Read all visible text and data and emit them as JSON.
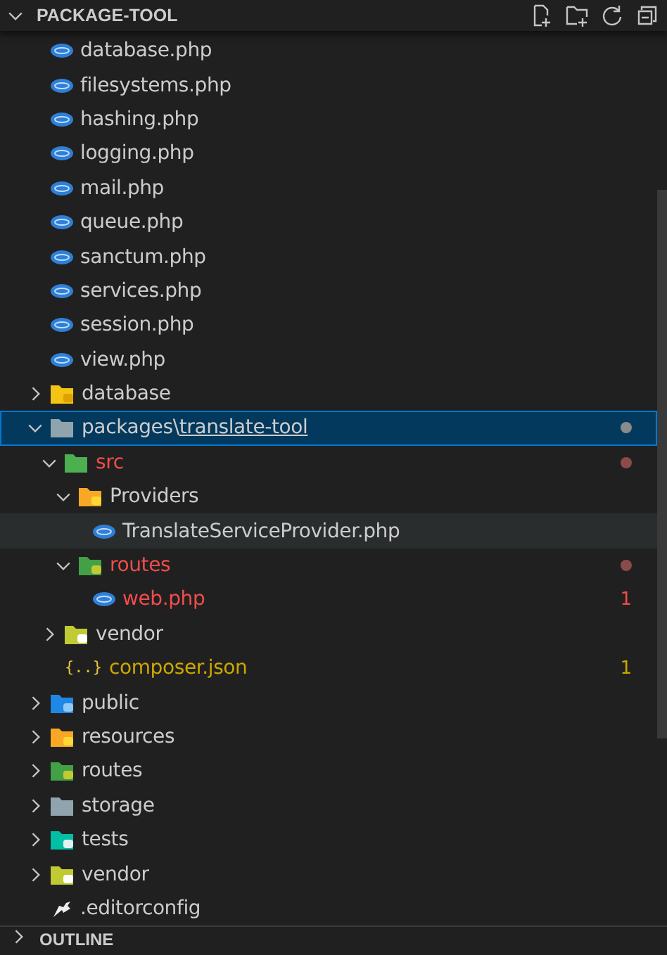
{
  "header": {
    "title": "PACKAGE-TOOL",
    "expanded": true
  },
  "tree": [
    {
      "kind": "scrolled-folder",
      "children": [
        {
          "kind": "php",
          "label": "database.php"
        },
        {
          "kind": "php",
          "label": "filesystems.php"
        },
        {
          "kind": "php",
          "label": "hashing.php"
        },
        {
          "kind": "php",
          "label": "logging.php"
        },
        {
          "kind": "php",
          "label": "mail.php"
        },
        {
          "kind": "php",
          "label": "queue.php"
        },
        {
          "kind": "php",
          "label": "sanctum.php"
        },
        {
          "kind": "php",
          "label": "services.php"
        },
        {
          "kind": "php",
          "label": "session.php"
        },
        {
          "kind": "php",
          "label": "view.php"
        }
      ]
    },
    {
      "kind": "folder-database",
      "label": "database",
      "expanded": false,
      "selected": false
    },
    {
      "kind": "folder-plain",
      "label": "packages",
      "separator": "\\",
      "sublabel": "translate-tool",
      "expanded": true,
      "selected": true,
      "dot": true,
      "children": [
        {
          "kind": "folder-src",
          "label": "src",
          "expanded": true,
          "selected": false,
          "error": true,
          "dot": true,
          "children": [
            {
              "kind": "folder-providers",
              "label": "Providers",
              "expanded": true,
              "selected": false,
              "children": [
                {
                  "kind": "php",
                  "label": "TranslateServiceProvider.php",
                  "hovered": true
                }
              ]
            },
            {
              "kind": "folder-routes",
              "label": "routes",
              "expanded": true,
              "selected": false,
              "error": true,
              "dot": true,
              "children": [
                {
                  "kind": "php",
                  "label": "web.php",
                  "error": true,
                  "badge": "1"
                }
              ]
            }
          ]
        },
        {
          "kind": "folder-vendor",
          "label": "vendor",
          "expanded": false,
          "selected": false
        },
        {
          "kind": "json",
          "glyph": "{..}",
          "label": "composer.json",
          "warning": true,
          "badge": "1"
        }
      ]
    },
    {
      "kind": "folder-public",
      "label": "public",
      "expanded": false,
      "selected": false
    },
    {
      "kind": "folder-resources",
      "label": "resources",
      "expanded": false,
      "selected": false
    },
    {
      "kind": "folder-routes",
      "label": "routes",
      "expanded": false,
      "selected": false
    },
    {
      "kind": "folder-plain",
      "label": "storage",
      "expanded": false,
      "selected": false
    },
    {
      "kind": "folder-tests",
      "label": "tests",
      "expanded": false,
      "selected": false
    },
    {
      "kind": "folder-vendor",
      "label": "vendor",
      "expanded": false,
      "selected": false
    },
    {
      "kind": "config",
      "label": ".editorconfig"
    }
  ],
  "footer": {
    "title": "OUTLINE",
    "expanded": false
  }
}
